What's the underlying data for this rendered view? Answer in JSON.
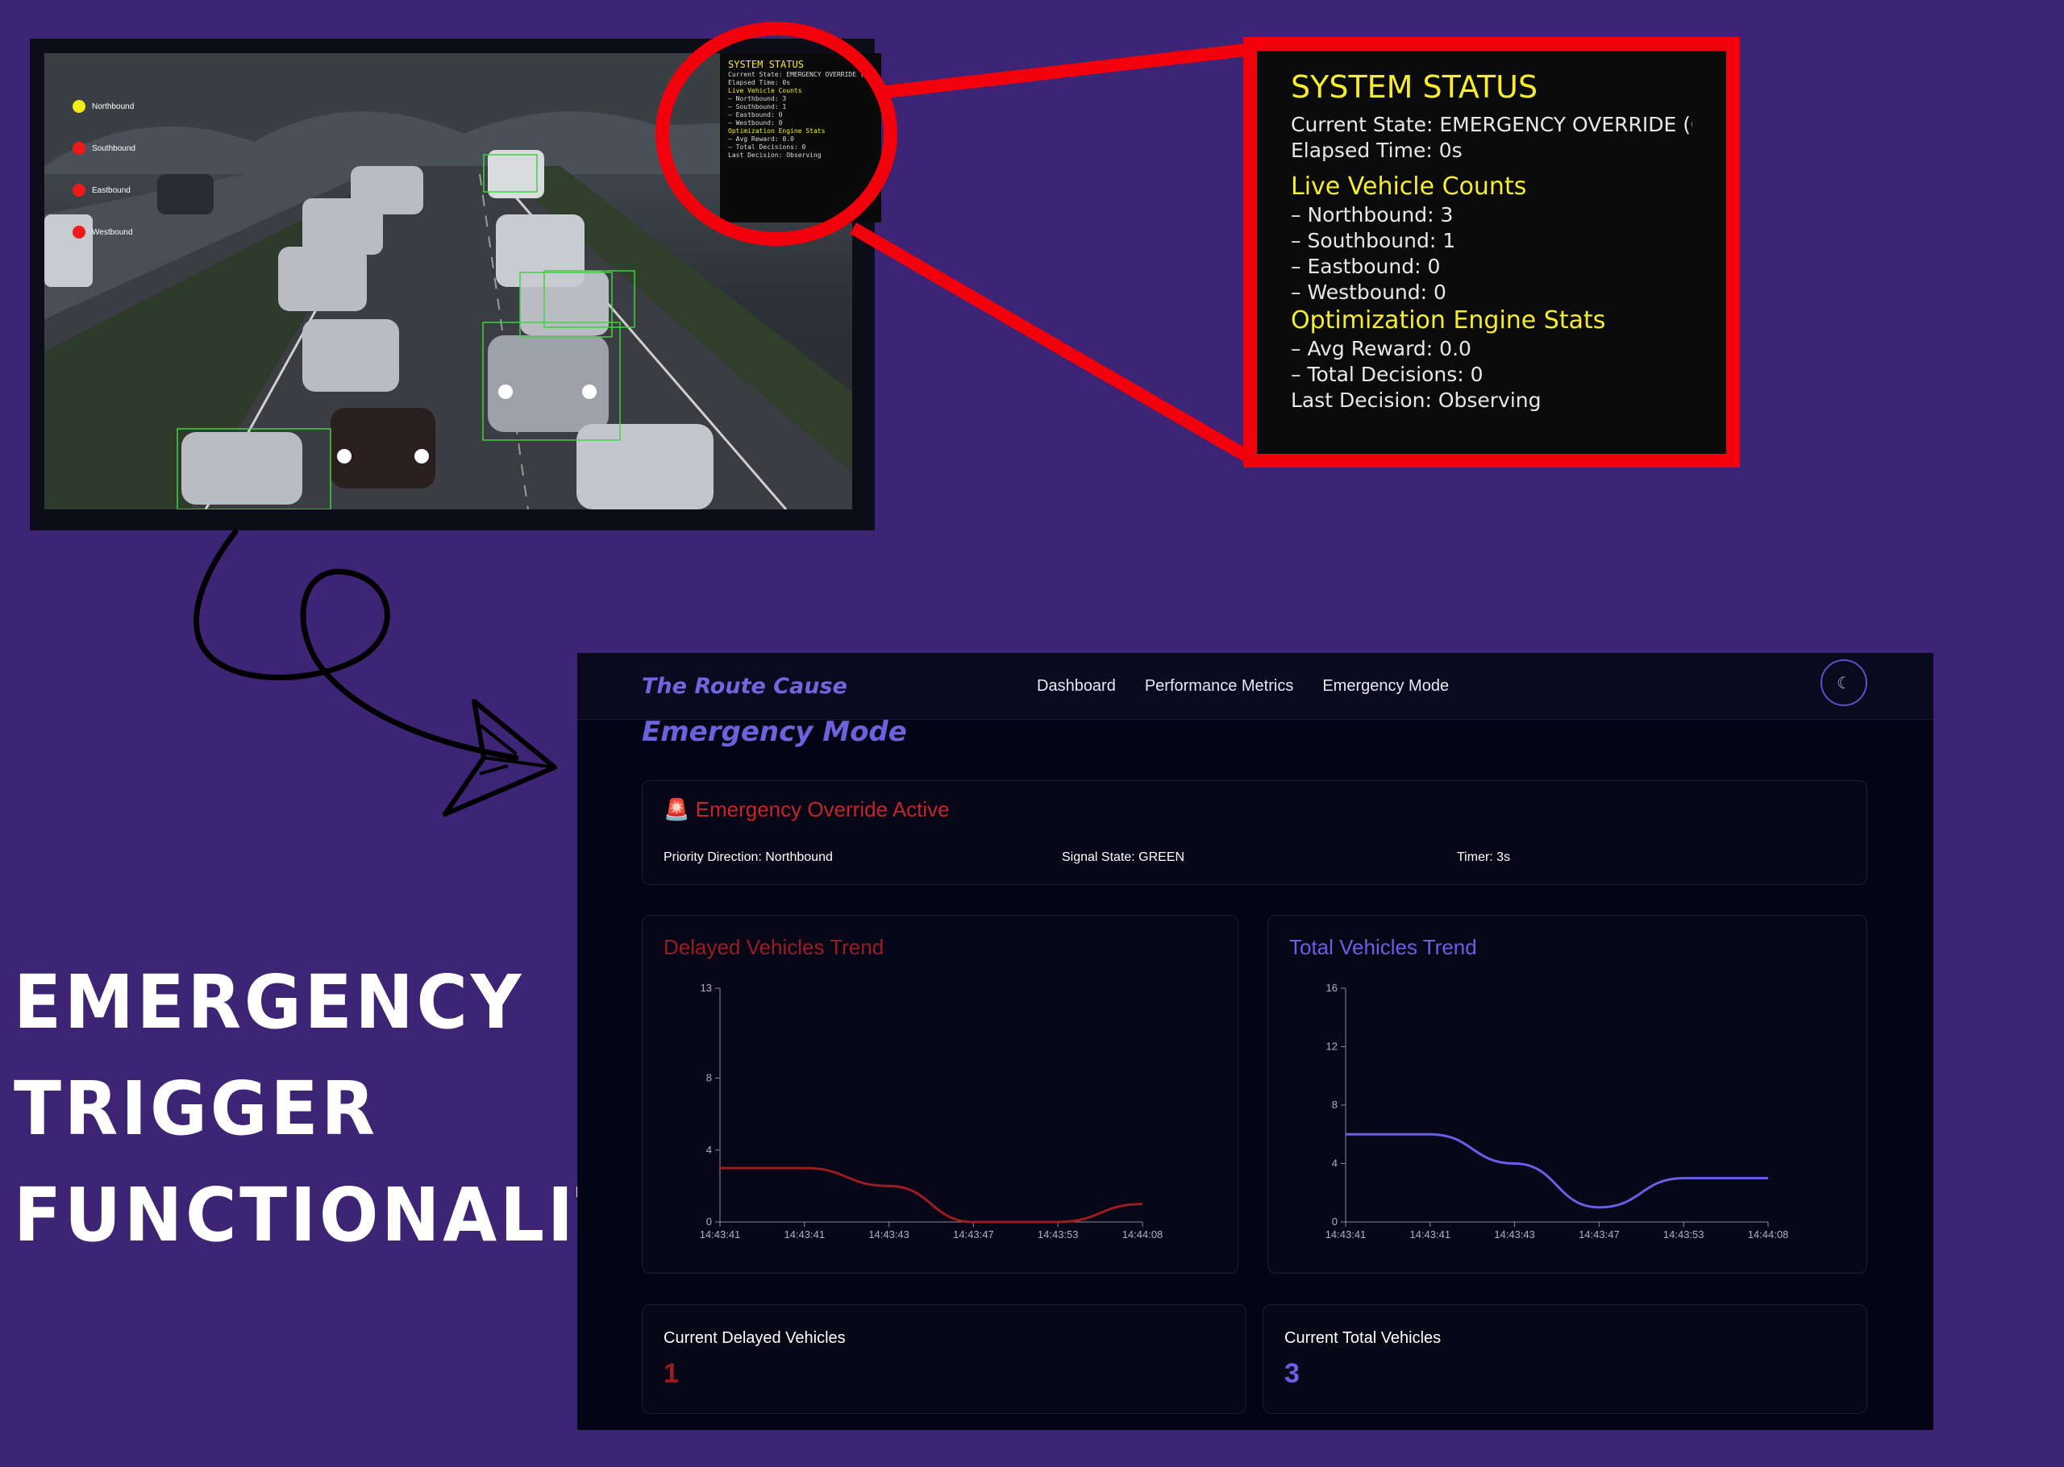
{
  "video": {
    "legend": [
      {
        "label": "Northbound",
        "color": "#f3ec1d"
      },
      {
        "label": "Southbound",
        "color": "#ee1a1a"
      },
      {
        "label": "Eastbound",
        "color": "#ee1a1a"
      },
      {
        "label": "Westbound",
        "color": "#ee1a1a"
      }
    ]
  },
  "system_status": {
    "title": "SYSTEM STATUS",
    "current_state": "Current State: EMERGENCY OVERRIDE (CL",
    "elapsed_time": "Elapsed Time: 0s",
    "counts_heading": "Live Vehicle Counts",
    "northbound": "– Northbound: 3",
    "southbound": "– Southbound: 1",
    "eastbound": "– Eastbound: 0",
    "westbound": "– Westbound: 0",
    "engine_heading": "Optimization Engine Stats",
    "avg_reward": "– Avg Reward: 0.0",
    "total_decisions": "– Total Decisions: 0",
    "last_decision": "Last Decision: Observing"
  },
  "caption": {
    "line1": "EMERGENCY",
    "line2": "TRIGGER",
    "line3": "FUNCTIONALITY"
  },
  "dashboard": {
    "brand": "The Route Cause",
    "nav": {
      "dashboard": "Dashboard",
      "performance": "Performance Metrics",
      "emergency": "Emergency Mode"
    },
    "theme_icon": "moon-icon",
    "page_title": "Emergency Mode",
    "alert": {
      "icon": "🚨",
      "title": "Emergency Override Active",
      "priority": "Priority Direction: Northbound",
      "signal": "Signal State: GREEN",
      "timer": "Timer: 3s"
    },
    "stats": {
      "delayed_label": "Current Delayed Vehicles",
      "delayed_value": "1",
      "total_label": "Current Total Vehicles",
      "total_value": "3"
    }
  },
  "chart_data": [
    {
      "type": "line",
      "title": "Delayed Vehicles Trend",
      "color": "#9b1c22",
      "x": [
        "14:43:41",
        "14:43:41",
        "14:43:43",
        "14:43:47",
        "14:43:53",
        "14:44:08"
      ],
      "y_ticks": [
        0,
        4,
        8,
        13
      ],
      "ylim": [
        0,
        13
      ],
      "values": [
        3,
        3,
        2,
        0,
        0,
        1
      ]
    },
    {
      "type": "line",
      "title": "Total Vehicles Trend",
      "color": "#6a5fe6",
      "x": [
        "14:43:41",
        "14:43:41",
        "14:43:43",
        "14:43:47",
        "14:43:53",
        "14:44:08"
      ],
      "y_ticks": [
        0,
        4,
        8,
        12,
        16
      ],
      "ylim": [
        0,
        16
      ],
      "values": [
        6,
        6,
        4,
        1,
        3,
        3
      ]
    }
  ]
}
